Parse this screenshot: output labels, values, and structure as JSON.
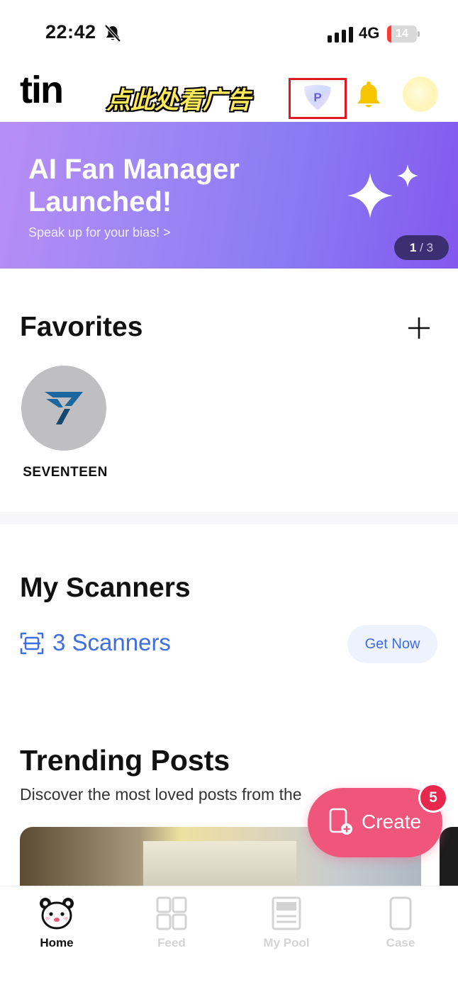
{
  "status_bar": {
    "time": "22:42",
    "network": "4G",
    "battery": "14",
    "battery_level": 0.14
  },
  "header": {
    "logo": "tin",
    "ad_text": "点此处看广告",
    "premium_badge": "P"
  },
  "banner": {
    "title": "AI Fan Manager Launched!",
    "subtitle": "Speak up for your bias! >",
    "pager_current": "1",
    "pager_sep": "/",
    "pager_total": "3"
  },
  "favorites": {
    "title": "Favorites",
    "items": [
      {
        "label": "SEVENTEEN"
      }
    ]
  },
  "scanners": {
    "title": "My Scanners",
    "count_text": "3 Scanners",
    "cta": "Get Now"
  },
  "trending": {
    "title": "Trending Posts",
    "subtitle": "Discover the most loved posts from the"
  },
  "fab": {
    "label": "Create",
    "badge": "5"
  },
  "bottom_nav": {
    "items": [
      {
        "label": "Home",
        "icon": "bear-icon"
      },
      {
        "label": "Feed",
        "icon": "grid-icon"
      },
      {
        "label": "My Pool",
        "icon": "pool-icon"
      },
      {
        "label": "Case",
        "icon": "phone-case-icon"
      }
    ]
  },
  "colors": {
    "accent_blue": "#3d6fe3",
    "fab_pink": "#f0567b",
    "banner_purple": "#8a79f3",
    "highlight_red": "#e0181f"
  }
}
